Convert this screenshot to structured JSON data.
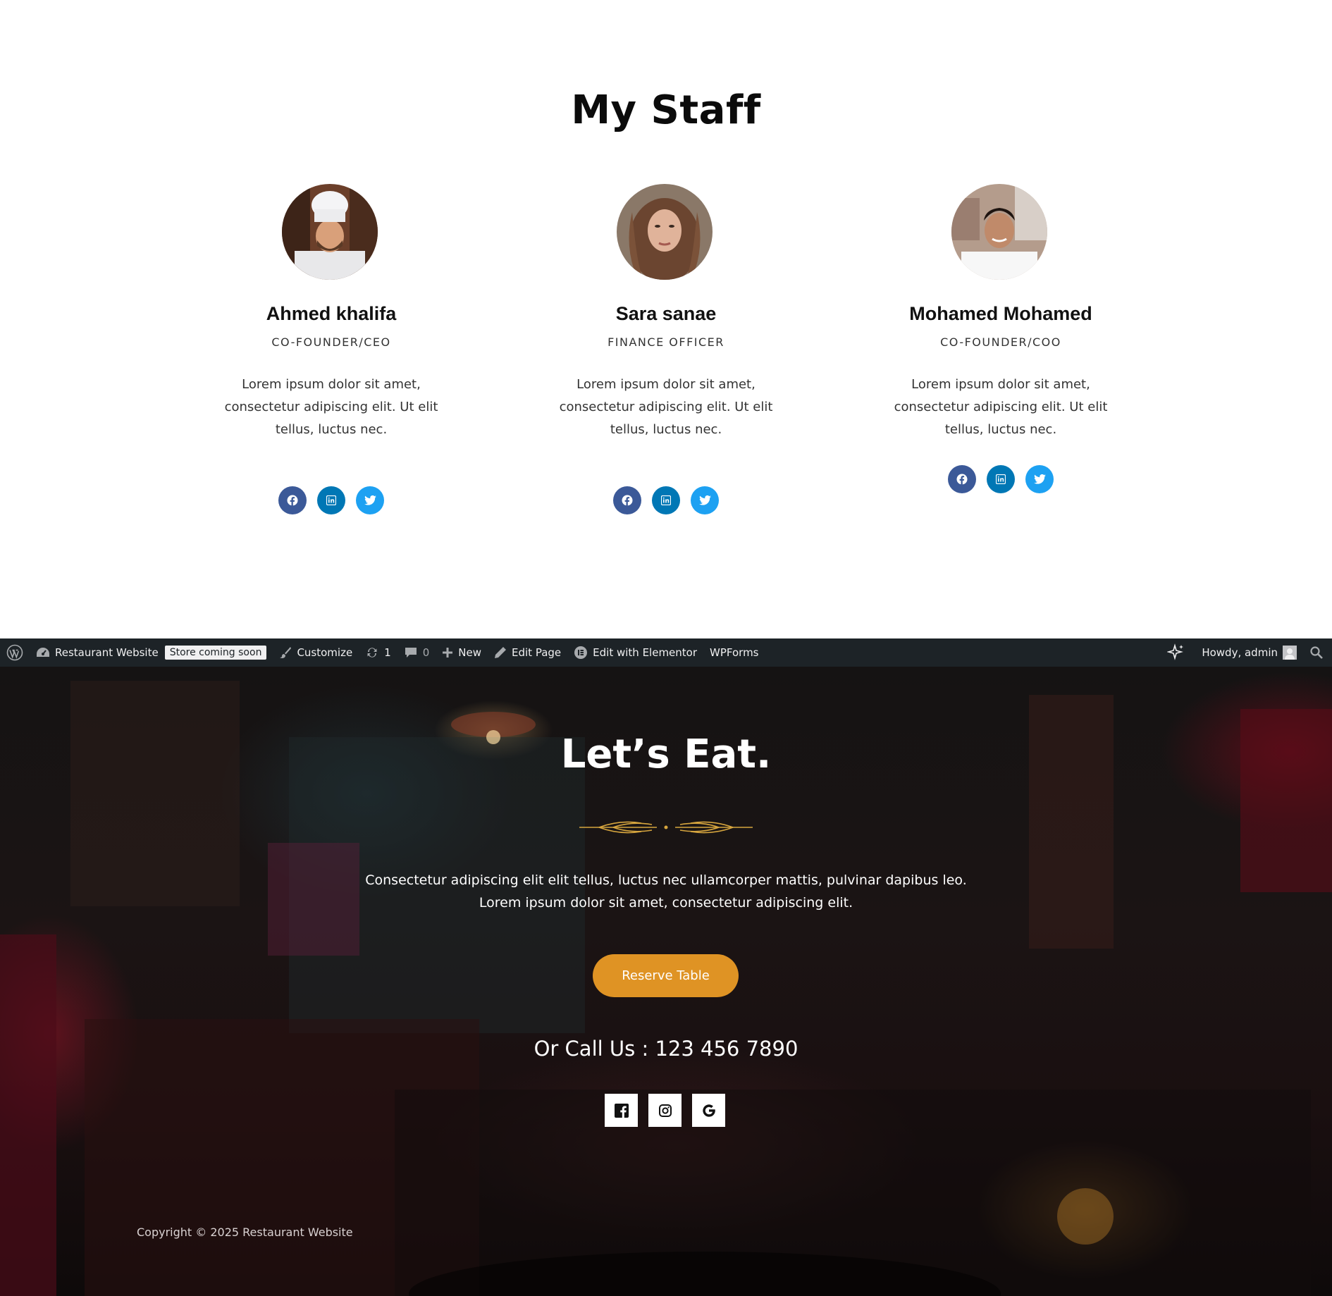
{
  "staff": {
    "title": "My Staff",
    "members": [
      {
        "name": "Ahmed khalifa",
        "role": "CO-FOUNDER/CEO",
        "bio": "Lorem ipsum dolor sit amet, consectetur adipiscing elit. Ut elit tellus, luctus nec."
      },
      {
        "name": "Sara sanae",
        "role": "FINANCE OFFICER",
        "bio": "Lorem ipsum dolor sit amet, consectetur adipiscing elit. Ut elit tellus, luctus nec."
      },
      {
        "name": "Mohamed Mohamed",
        "role": "CO-FOUNDER/COO",
        "bio": "Lorem ipsum dolor sit amet, consectetur adipiscing elit. Ut elit tellus, luctus nec."
      }
    ],
    "social_icons": [
      "facebook-icon",
      "linkedin-icon",
      "twitter-icon"
    ],
    "colors": {
      "facebook": "#3b5998",
      "linkedin": "#0077b5",
      "twitter": "#1da1f2"
    }
  },
  "adminbar": {
    "site_name": "Restaurant Website",
    "store_badge": "Store coming soon",
    "customize": "Customize",
    "updates_count": "1",
    "comments_count": "0",
    "new": "New",
    "edit_page": "Edit Page",
    "edit_elementor": "Edit with Elementor",
    "wpforms": "WPForms",
    "howdy": "Howdy, admin"
  },
  "hero": {
    "title": "Let’s Eat.",
    "text_line1": "Consectetur adipiscing elit elit tellus, luctus nec ullamcorper mattis, pulvinar dapibus leo.",
    "text_line2": "Lorem ipsum dolor sit amet, consectetur adipiscing elit.",
    "button": "Reserve Table",
    "call": "Or Call Us : 123 456 7890",
    "social_icons": [
      "facebook-square-icon",
      "instagram-icon",
      "google-icon"
    ],
    "accent_color": "#df9324"
  },
  "footer": {
    "copyright": "Copyright © 2025 Restaurant Website"
  }
}
